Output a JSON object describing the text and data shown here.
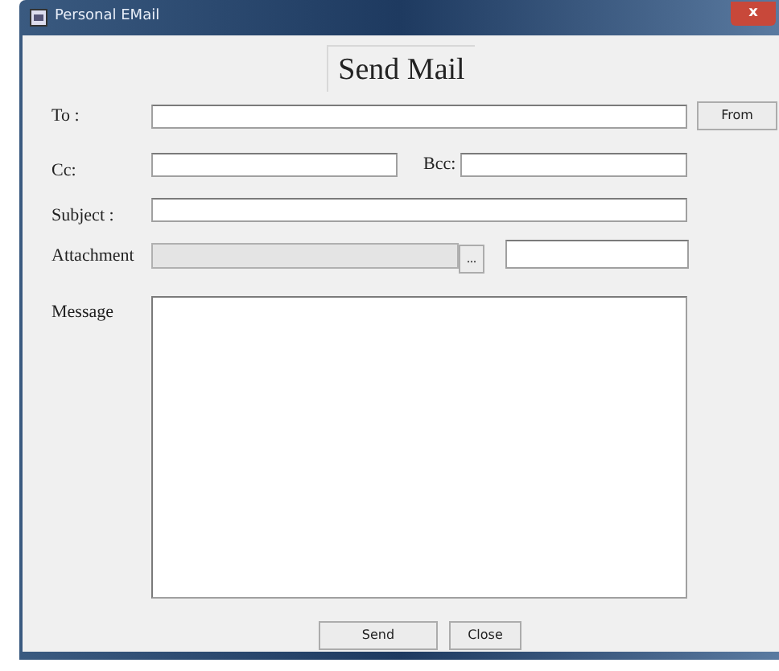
{
  "window": {
    "title": "Personal EMail",
    "close": "x"
  },
  "heading": "Send Mail",
  "to": {
    "label": "To :"
  },
  "from_button": "From",
  "cc": {
    "label": "Cc:"
  },
  "bcc": {
    "label": "Bcc:"
  },
  "subject": {
    "label": "Subject :"
  },
  "attachment": {
    "label": "Attachment",
    "disabled": true,
    "browse": "..."
  },
  "message": {
    "label": "Message"
  },
  "buttons": [
    "Send",
    "Close"
  ]
}
